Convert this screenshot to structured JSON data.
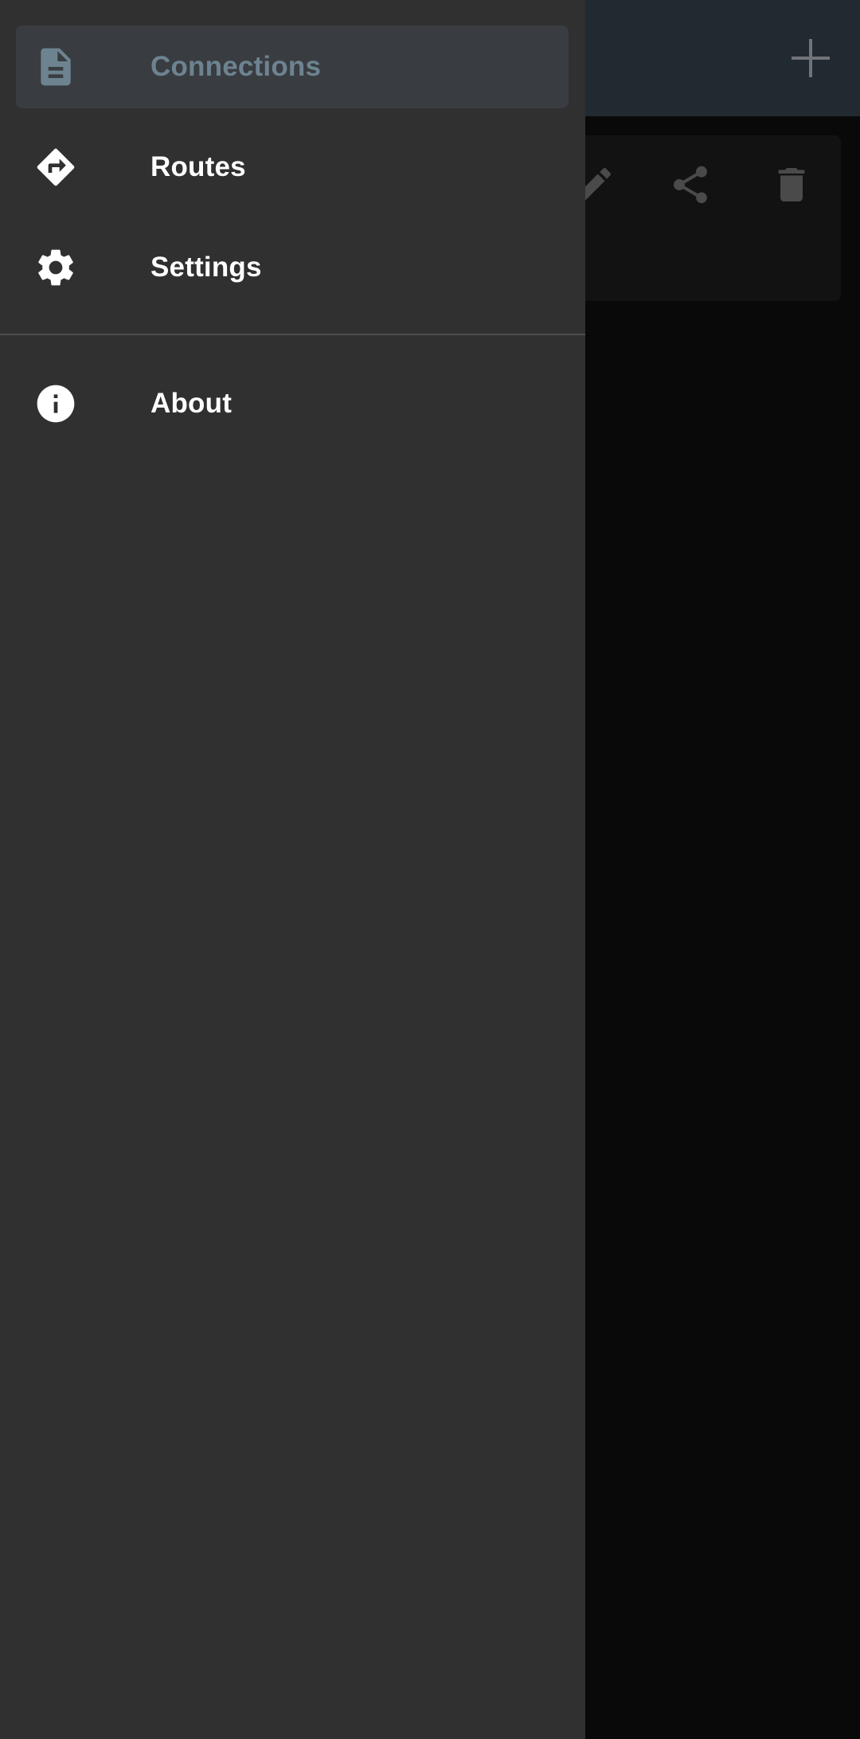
{
  "background_app": {
    "toolbar": {
      "add_icon": "plus-icon"
    },
    "card": {
      "actions": [
        "edit-icon",
        "share-icon",
        "delete-icon"
      ]
    }
  },
  "drawer": {
    "items": [
      {
        "label": "Connections",
        "icon": "document-icon",
        "active": true
      },
      {
        "label": "Routes",
        "icon": "directions-icon",
        "active": false
      },
      {
        "label": "Settings",
        "icon": "gear-icon",
        "active": false
      },
      {
        "label": "About",
        "icon": "info-icon",
        "active": false
      }
    ]
  },
  "colors": {
    "drawer_bg": "#303030",
    "active_item_bg": "#393d41",
    "active_text": "#6d8390",
    "text": "#ffffff",
    "toolbar_bg": "#222a31"
  }
}
